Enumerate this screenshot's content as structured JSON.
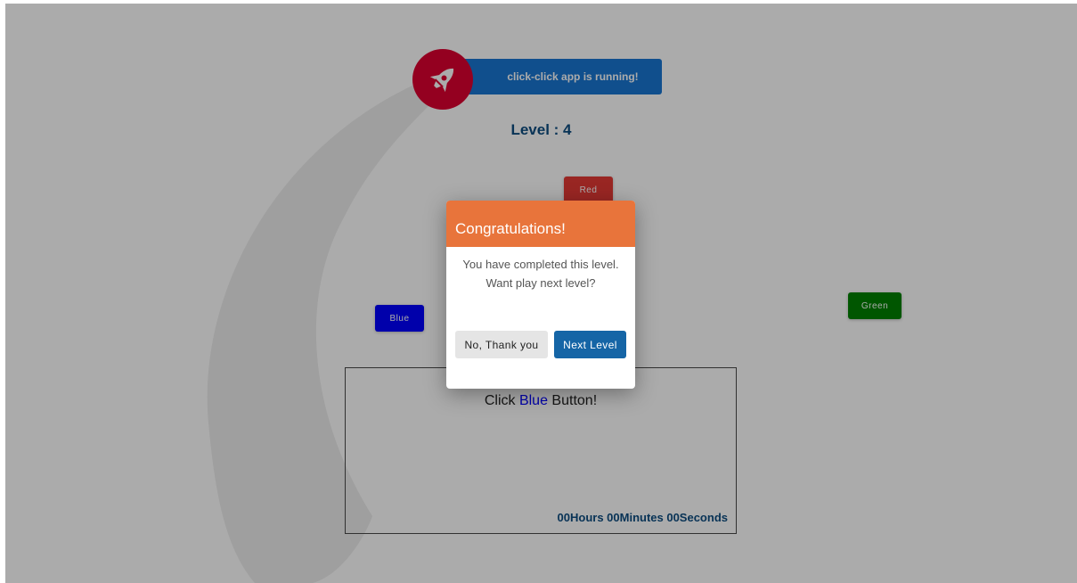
{
  "banner": {
    "text": "click-click app is running!",
    "icon": "rocket-icon",
    "color": "#1976d2",
    "badge_color": "#dd0031"
  },
  "level": {
    "label": "Level : 4"
  },
  "color_buttons": {
    "red": {
      "label": "Red",
      "color": "#e53935"
    },
    "blue": {
      "label": "Blue",
      "color": "#0000ff"
    },
    "green": {
      "label": "Green",
      "color": "#008000"
    }
  },
  "instruction": {
    "prefix": "Click ",
    "target": "Blue",
    "suffix": " Button!"
  },
  "timer": {
    "text": "00Hours 00Minutes 00Seconds"
  },
  "modal": {
    "title": "Congratulations!",
    "message": "You have completed this level. Want play next level?",
    "decline_label": "No, Thank you",
    "accept_label": "Next Level",
    "header_color": "#e8743b",
    "accept_color": "#1565a6"
  }
}
